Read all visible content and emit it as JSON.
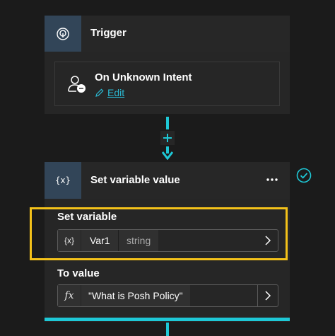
{
  "trigger": {
    "title": "Trigger",
    "icon": "trigger-icon",
    "name": "On Unknown Intent",
    "edit_label": "Edit"
  },
  "connector": {
    "add_icon": "plus-icon"
  },
  "set_variable_node": {
    "icon_text": "{x}",
    "title": "Set variable value",
    "more_icon": "ellipsis-icon",
    "status_icon": "check-circle-icon",
    "set_variable": {
      "label": "Set variable",
      "prefix": "{x}",
      "variable_name": "Var1",
      "variable_type": "string"
    },
    "to_value": {
      "label": "To value",
      "prefix": "fx",
      "value": "\"What is Posh Policy\""
    }
  },
  "colors": {
    "accent": "#1ec8d6",
    "highlight": "#f4c21a",
    "link": "#2bb7d0",
    "icon_box": "#324558"
  }
}
